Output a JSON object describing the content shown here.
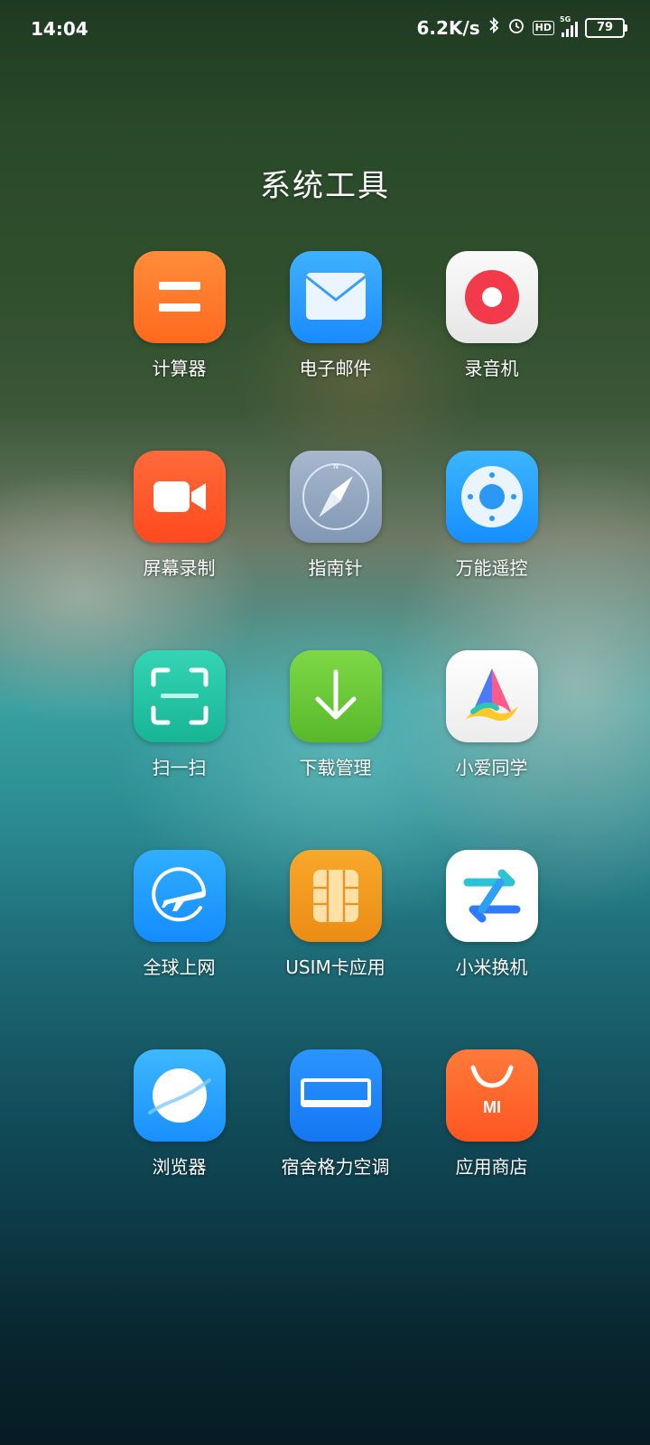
{
  "status_bar": {
    "time": "14:04",
    "network_speed": "6.2K/s",
    "hd_label": "HD",
    "network_type": "5G",
    "battery": "79"
  },
  "folder": {
    "title": "系统工具",
    "apps": [
      {
        "label": "计算器",
        "icon": "calculator-icon",
        "color": "#FF7A2E"
      },
      {
        "label": "电子邮件",
        "icon": "mail-icon",
        "color": "#2A9BFF"
      },
      {
        "label": "录音机",
        "icon": "recorder-icon",
        "color": "#F2F2F2"
      },
      {
        "label": "屏幕录制",
        "icon": "screen-record-icon",
        "color": "#FF5A2A"
      },
      {
        "label": "指南针",
        "icon": "compass-icon",
        "color": "#8FA6C2"
      },
      {
        "label": "万能遥控",
        "icon": "remote-control-icon",
        "color": "#2AA6FF"
      },
      {
        "label": "扫一扫",
        "icon": "scanner-icon",
        "color": "#27C7A6"
      },
      {
        "label": "下载管理",
        "icon": "download-icon",
        "color": "#6BC836"
      },
      {
        "label": "小爱同学",
        "icon": "xiaoai-icon",
        "color": "#F5F5F5"
      },
      {
        "label": "全球上网",
        "icon": "global-data-icon",
        "color": "#1E9BFF"
      },
      {
        "label": "USIM卡应用",
        "icon": "sim-card-icon",
        "color": "#F29A1F"
      },
      {
        "label": "小米换机",
        "icon": "mi-mover-icon",
        "color": "#FFFFFF"
      },
      {
        "label": "浏览器",
        "icon": "browser-icon",
        "color": "#28A8FF"
      },
      {
        "label": "宿舍格力空调",
        "icon": "air-conditioner-icon",
        "color": "#1E88FF"
      },
      {
        "label": "应用商店",
        "icon": "app-store-icon",
        "color": "#FF6A2A"
      }
    ]
  },
  "app_store_logo_text": "MI"
}
